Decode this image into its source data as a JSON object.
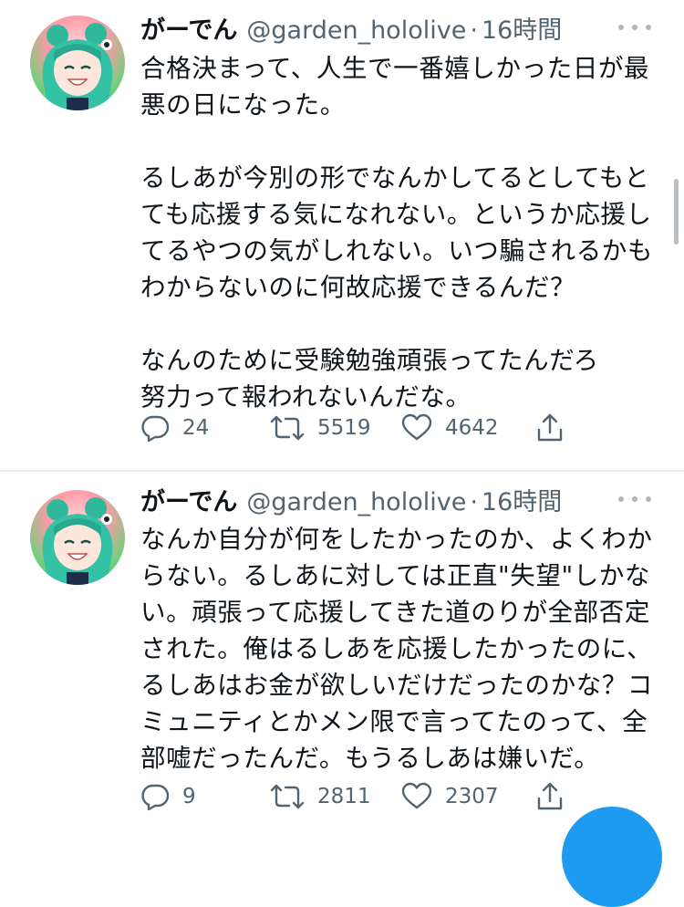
{
  "tweets": [
    {
      "display_name": "がーでん",
      "handle": "@garden_hololive",
      "separator": "·",
      "time": "16時間",
      "text": "合格決まって、人生で一番嬉しかった日が最悪の日になった。\n\nるしあが今別の形でなんかしてるとしてもとても応援する気になれない。というか応援してるやつの気がしれない。いつ騙されるかもわからないのに何故応援できるんだ？\n\nなんのために受験勉強頑張ってたんだろ\n努力って報われないんだな。",
      "replies": "24",
      "retweets": "5519",
      "likes": "4642"
    },
    {
      "display_name": "がーでん",
      "handle": "@garden_hololive",
      "separator": "·",
      "time": "16時間",
      "text": "なんか自分が何をしたかったのか、よくわからない。るしあに対しては正直\"失望\"しかない。頑張って応援してきた道のりが全部否定された。俺はるしあを応援したかったのに、るしあはお金が欲しいだけだったのかな？コミュニティとかメン限で言ってたのって、全部嘘だったんだ。もうるしあは嫌いだ。",
      "replies": "9",
      "retweets": "2811",
      "likes": "2307"
    }
  ],
  "icons": {
    "more": "more-dots-icon",
    "reply": "reply-bubble-icon",
    "retweet": "retweet-icon",
    "like": "heart-icon",
    "share": "share-icon",
    "avatar": "anime-avatar"
  },
  "colors": {
    "text": "#0f1419",
    "secondary": "#536471",
    "accent": "#1d9bf0",
    "divider": "#e6ecf0"
  }
}
